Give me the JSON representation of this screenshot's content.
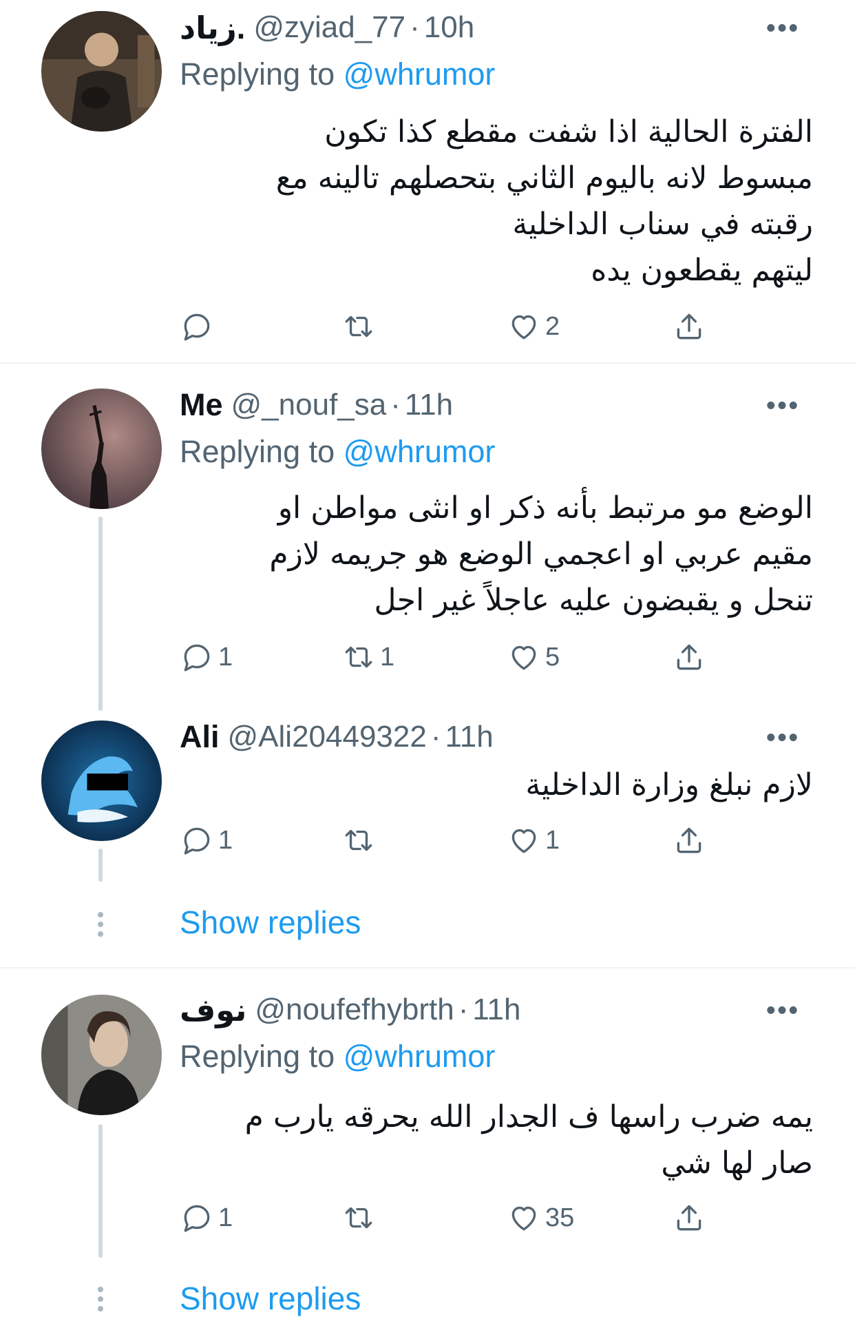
{
  "tweets": [
    {
      "name": "زياد.",
      "handle": "@zyiad_77",
      "separator": "·",
      "time": "10h",
      "more": "•••",
      "replying_prefix": "Replying to",
      "replying_mention": "@whrumor",
      "lines": [
        "الفترة الحالية اذا شفت مقطع كذا تكون",
        "مبسوط لانه باليوم الثاني بتحصلهم تالينه مع",
        "رقبته في سناب الداخلية",
        "ليتهم يقطعون يده"
      ],
      "counts": {
        "reply": "",
        "retweet": "",
        "like": "2"
      }
    },
    {
      "name": "Me",
      "handle": "@_nouf_sa",
      "separator": "·",
      "time": "11h",
      "more": "•••",
      "replying_prefix": "Replying to",
      "replying_mention": "@whrumor",
      "lines": [
        "الوضع مو مرتبط بأنه ذكر او انثى مواطن او",
        "مقيم عربي او اعجمي الوضع هو جريمه لازم",
        "تنحل و يقبضون عليه عاجلاً غير اجل"
      ],
      "counts": {
        "reply": "1",
        "retweet": "1",
        "like": "5"
      }
    },
    {
      "name": "Ali",
      "handle": "@Ali20449322",
      "separator": "·",
      "time": "11h",
      "more": "•••",
      "lines": [
        "لازم نبلغ وزارة الداخلية"
      ],
      "counts": {
        "reply": "1",
        "retweet": "",
        "like": "1"
      }
    },
    {
      "name": "نوف",
      "handle": "@noufefhybrth",
      "separator": "·",
      "time": "11h",
      "more": "•••",
      "replying_prefix": "Replying to",
      "replying_mention": "@whrumor",
      "lines": [
        "يمه ضرب راسها ف الجدار الله يحرقه يارب م",
        "صار لها شي"
      ],
      "counts": {
        "reply": "1",
        "retweet": "",
        "like": "35"
      }
    }
  ],
  "show_replies": "Show replies",
  "colors": {
    "accent": "#1d9bf0",
    "secondary": "#536471",
    "text": "#0f1419",
    "line": "#cfd9de"
  }
}
